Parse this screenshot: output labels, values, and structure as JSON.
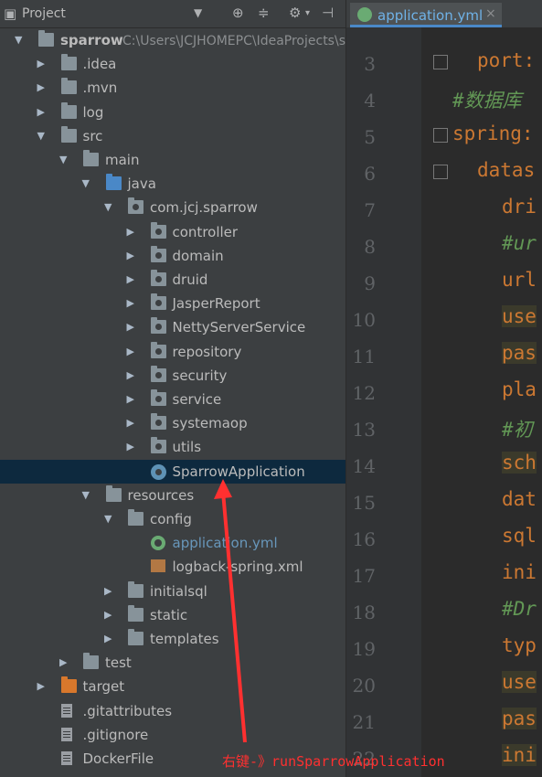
{
  "project_panel": {
    "title": "Project",
    "dropdown_icon": "caret-down",
    "toolbar_icons": [
      "target-icon",
      "collapse-icon",
      "gear-icon",
      "hide-icon"
    ]
  },
  "tree": [
    {
      "label": "sparrow",
      "path": "C:\\Users\\JCJHOMEPC\\IdeaProjects\\sp",
      "depth": 0,
      "expanded": true,
      "icon": "folder"
    },
    {
      "label": ".idea",
      "depth": 1,
      "expanded": false,
      "icon": "folder"
    },
    {
      "label": ".mvn",
      "depth": 1,
      "expanded": false,
      "icon": "folder"
    },
    {
      "label": "log",
      "depth": 1,
      "expanded": false,
      "icon": "folder"
    },
    {
      "label": "src",
      "depth": 1,
      "expanded": true,
      "icon": "folder"
    },
    {
      "label": "main",
      "depth": 2,
      "expanded": true,
      "icon": "folder"
    },
    {
      "label": "java",
      "depth": 3,
      "expanded": true,
      "icon": "folder-blue"
    },
    {
      "label": "com.jcj.sparrow",
      "depth": 4,
      "expanded": true,
      "icon": "package"
    },
    {
      "label": "controller",
      "depth": 5,
      "expanded": false,
      "icon": "package"
    },
    {
      "label": "domain",
      "depth": 5,
      "expanded": false,
      "icon": "package"
    },
    {
      "label": "druid",
      "depth": 5,
      "expanded": false,
      "icon": "package"
    },
    {
      "label": "JasperReport",
      "depth": 5,
      "expanded": false,
      "icon": "package"
    },
    {
      "label": "NettyServerService",
      "depth": 5,
      "expanded": false,
      "icon": "package"
    },
    {
      "label": "repository",
      "depth": 5,
      "expanded": false,
      "icon": "package"
    },
    {
      "label": "security",
      "depth": 5,
      "expanded": false,
      "icon": "package"
    },
    {
      "label": "service",
      "depth": 5,
      "expanded": false,
      "icon": "package"
    },
    {
      "label": "systemaop",
      "depth": 5,
      "expanded": false,
      "icon": "package"
    },
    {
      "label": "utils",
      "depth": 5,
      "expanded": false,
      "icon": "package"
    },
    {
      "label": "SparrowApplication",
      "depth": 5,
      "leaf": true,
      "icon": "spring-class",
      "selected": true
    },
    {
      "label": "resources",
      "depth": 3,
      "expanded": true,
      "icon": "folder"
    },
    {
      "label": "config",
      "depth": 4,
      "expanded": true,
      "icon": "folder"
    },
    {
      "label": "application.yml",
      "depth": 5,
      "leaf": true,
      "icon": "spring-yml",
      "blue": true
    },
    {
      "label": "logback-spring.xml",
      "depth": 5,
      "leaf": true,
      "icon": "xml"
    },
    {
      "label": "initialsql",
      "depth": 4,
      "expanded": false,
      "icon": "folder"
    },
    {
      "label": "static",
      "depth": 4,
      "expanded": false,
      "icon": "folder"
    },
    {
      "label": "templates",
      "depth": 4,
      "expanded": false,
      "icon": "folder"
    },
    {
      "label": "test",
      "depth": 2,
      "expanded": false,
      "icon": "folder"
    },
    {
      "label": "target",
      "depth": 1,
      "expanded": false,
      "icon": "folder-orange"
    },
    {
      "label": ".gitattributes",
      "depth": 1,
      "leaf": true,
      "icon": "file"
    },
    {
      "label": ".gitignore",
      "depth": 1,
      "leaf": true,
      "icon": "file"
    },
    {
      "label": "DockerFile",
      "depth": 1,
      "leaf": true,
      "icon": "file"
    }
  ],
  "editor": {
    "tab_label": "application.yml",
    "tab_close": "×",
    "lines": [
      {
        "num": "3",
        "text": "port:",
        "indent": 1,
        "kind": "key"
      },
      {
        "num": "4",
        "text": "#数据库",
        "indent": 0,
        "kind": "comment"
      },
      {
        "num": "5",
        "text": "spring:",
        "indent": 0,
        "kind": "key"
      },
      {
        "num": "6",
        "text": "datas",
        "indent": 1,
        "kind": "key"
      },
      {
        "num": "7",
        "text": "dri",
        "indent": 2,
        "kind": "key"
      },
      {
        "num": "8",
        "text": "#ur",
        "indent": 2,
        "kind": "comment"
      },
      {
        "num": "9",
        "text": "url",
        "indent": 2,
        "kind": "key"
      },
      {
        "num": "10",
        "text": "use",
        "indent": 2,
        "kind": "key",
        "hl": true
      },
      {
        "num": "11",
        "text": "pas",
        "indent": 2,
        "kind": "key",
        "hl": true
      },
      {
        "num": "12",
        "text": "pla",
        "indent": 2,
        "kind": "key"
      },
      {
        "num": "13",
        "text": "#初",
        "indent": 2,
        "kind": "comment"
      },
      {
        "num": "14",
        "text": "sch",
        "indent": 2,
        "kind": "key",
        "hl": true
      },
      {
        "num": "15",
        "text": "dat",
        "indent": 2,
        "kind": "key"
      },
      {
        "num": "16",
        "text": "sql",
        "indent": 2,
        "kind": "key"
      },
      {
        "num": "17",
        "text": "ini",
        "indent": 2,
        "kind": "key"
      },
      {
        "num": "18",
        "text": "#Dr",
        "indent": 2,
        "kind": "comment"
      },
      {
        "num": "19",
        "text": "typ",
        "indent": 2,
        "kind": "key"
      },
      {
        "num": "20",
        "text": "use",
        "indent": 2,
        "kind": "key",
        "hl": true
      },
      {
        "num": "21",
        "text": "pas",
        "indent": 2,
        "kind": "key",
        "hl": true
      },
      {
        "num": "22",
        "text": "ini",
        "indent": 2,
        "kind": "key",
        "hl": true
      }
    ]
  },
  "annotation": {
    "text": "右键-》runSparrowApplication",
    "color": "#ff3030"
  },
  "colors": {
    "panel_bg": "#3c3f41",
    "editor_bg": "#2b2b2b",
    "selection": "#0d293e",
    "key_color": "#cc7832",
    "comment_color": "#629755"
  }
}
